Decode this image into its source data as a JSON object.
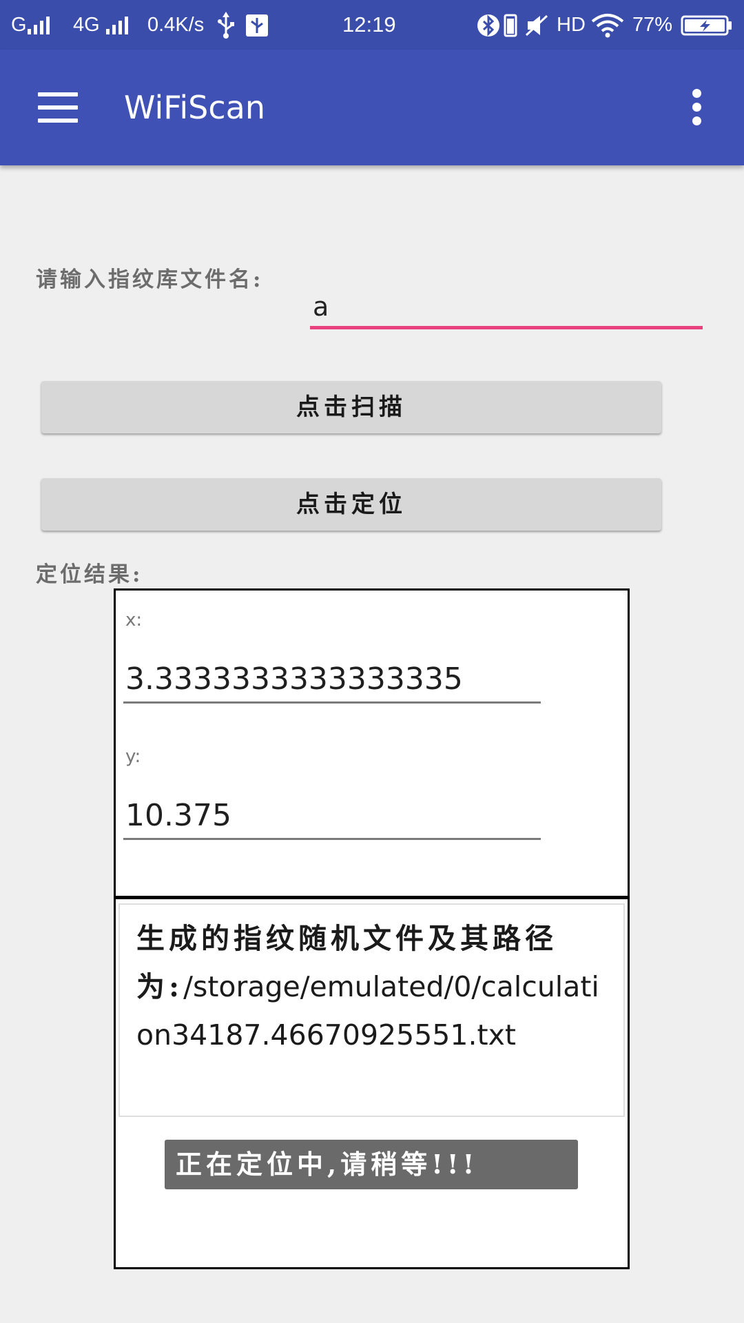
{
  "status_bar": {
    "carrier_1": "G",
    "network_type": "4G",
    "speed": "0.4K/s",
    "time": "12:19",
    "hd": "HD",
    "battery_percent": "77%",
    "icons": [
      "signal-icon",
      "usb-icon",
      "usb-debug-icon",
      "bluetooth-icon",
      "vibrate-icon",
      "mute-icon",
      "wifi-icon",
      "battery-charging-icon"
    ]
  },
  "app_bar": {
    "title": "WiFiScan",
    "menu_icon": "hamburger-menu-icon",
    "overflow_icon": "more-vert-icon",
    "color": "#3f51b5"
  },
  "form": {
    "filename_label": "请输入指纹库文件名:",
    "filename_value": "a",
    "accent_color": "#e8417d"
  },
  "buttons": {
    "scan_label": "点击扫描",
    "locate_label": "点击定位"
  },
  "result": {
    "label": "定位结果:",
    "x_label": "x:",
    "x_value": "3.3333333333333335",
    "y_label": "y:",
    "y_value": "10.375",
    "file_prefix": "生成的指纹随机文件及其路径为:",
    "file_path": "/storage/emulated/0/calculation34187.46670925551.txt"
  },
  "toast": {
    "message": "正在定位中,请稍等!!!"
  }
}
